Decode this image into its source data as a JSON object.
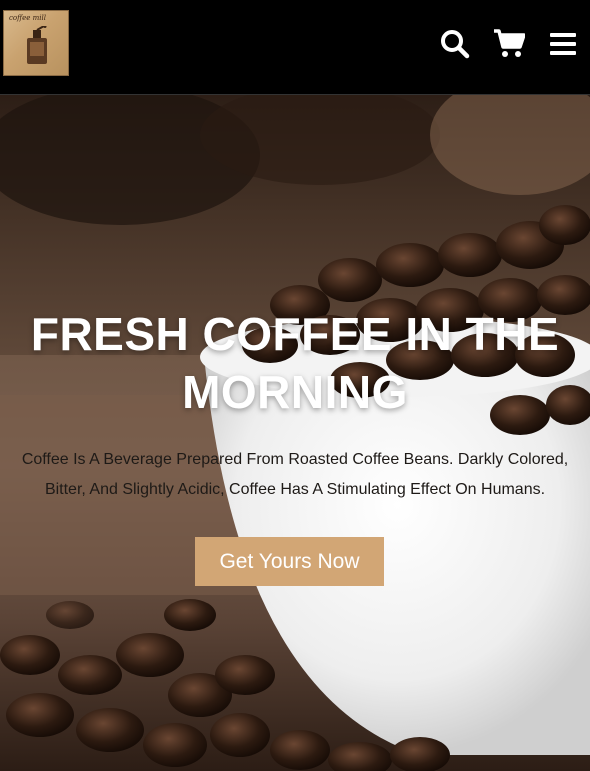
{
  "header": {
    "logo_text": "coffee mill",
    "icons": [
      "search-icon",
      "cart-icon",
      "menu-icon"
    ]
  },
  "hero": {
    "title_line1": "FRESH COFFEE IN THE",
    "title_line2": "MORNING",
    "description_line1": "Coffee Is A Beverage Prepared From Roasted Coffee Beans. Darkly Colored,",
    "description_line2": "Bitter, And Slightly Acidic, Coffee Has A Stimulating Effect On Humans.",
    "cta_label": "Get Yours Now"
  },
  "colors": {
    "header_bg": "#000000",
    "cta_bg": "#d2a675",
    "title_color": "#ffffff",
    "desc_color": "#1e1a17"
  }
}
